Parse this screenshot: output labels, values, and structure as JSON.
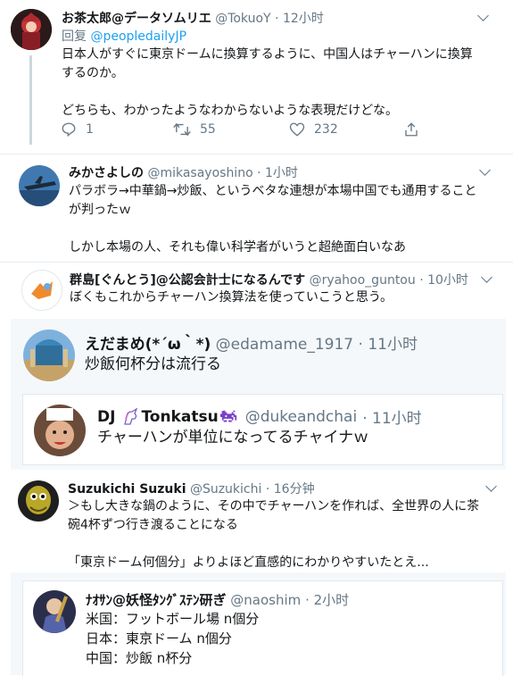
{
  "tweets": [
    {
      "name": "お茶太郎@データソムリエ",
      "handle": "@TokuoY",
      "time": "· 12小时",
      "reply_prefix": "回复",
      "reply_to": "@peopledailyJP",
      "lines": [
        "日本人がすぐに東京ドームに換算するように、中国人はチャーハンに換算",
        "するのか。",
        "",
        "どちらも、わかったようなわからないような表現だけどな。"
      ],
      "actions": {
        "reply": "1",
        "retweet": "55",
        "like": "232"
      }
    },
    {
      "name": "みかさよしの",
      "handle": "@mikasayoshino",
      "time": "· 1小时",
      "lines": [
        "パラボラ→中華鍋→炒飯、というベタな連想が本場中国でも通用すること",
        "が判ったｗ",
        "",
        "しかし本場の人、それも偉い科学者がいうと超絶面白いなあ"
      ]
    },
    {
      "name": "群島[ぐんとう]@公認会計士になるんです",
      "handle": "@ryahoo_guntou",
      "time": "· 10小时",
      "lines": [
        "ぼくもこれからチャーハン換算法を使っていこうと思う。"
      ]
    },
    {
      "name": "えだまめ(*´ω｀*)",
      "handle": "@edamame_1917",
      "time": "· 11小时",
      "lines": [
        "炒飯何杯分は流行る"
      ]
    },
    {
      "name_prefix": "DJ",
      "name": "Tonkatsu",
      "handle": "@dukeandchai",
      "time": "· 11小时",
      "lines": [
        "チャーハンが単位になってるチャイナｗ"
      ]
    },
    {
      "name": "Suzukichi Suzuki",
      "handle": "@Suzukichi",
      "time": "· 16分钟",
      "lines": [
        "＞もし大きな鍋のように、その中でチャーハンを作れば、全世界の人に茶",
        "碗4杯ずつ行き渡ることになる",
        "",
        "「東京ドーム何個分」よりよほど直感的にわかりやすいたとえ..."
      ]
    },
    {
      "name": "ﾅｵｻﾝ@妖怪ﾀﾝｸﾞｽﾃﾝ研ぎ",
      "handle": "@naoshim",
      "time": "· 2小时",
      "lines": [
        "米国：フットボール場 n個分",
        "日本：東京ドーム n個分",
        "中国：炒飯 n杯分"
      ]
    }
  ],
  "colors": {
    "link": "#1da1f2",
    "muted": "#657786",
    "card_bg": "#f5f8fa",
    "border": "#e1e8ed"
  },
  "icons": [
    "reply-icon",
    "retweet-icon",
    "like-icon",
    "share-icon",
    "chevron-down-icon",
    "unicorn-icon",
    "space-invader-icon"
  ]
}
